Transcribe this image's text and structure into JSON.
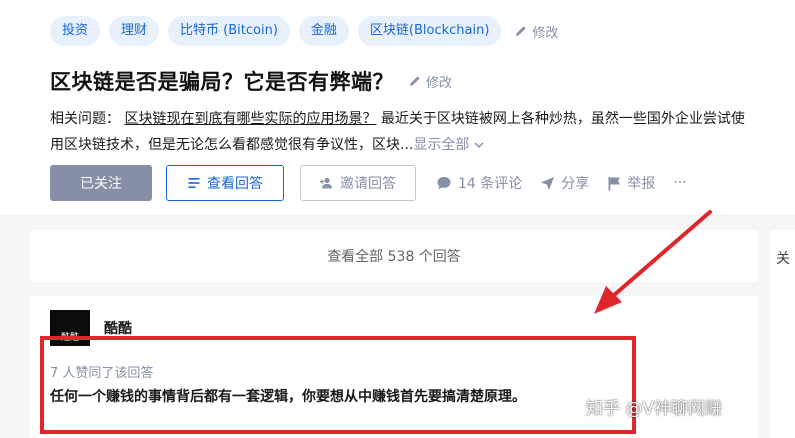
{
  "question": {
    "topics": [
      "投资",
      "理财",
      "比特币 (Bitcoin)",
      "金融",
      "区块链(Blockchain)"
    ],
    "topics_edit_label": "修改",
    "title": "区块链是否是骗局？它是否有弊端？",
    "title_edit_label": "修改",
    "detail_prefix": "相关问题：",
    "related_link": "区块链现在到底有哪些实际的应用场景？",
    "detail_text": "最近关于区块链被网上各种炒热，虽然一些国外企业尝试使用区块链技术，但是无论怎么看都感觉很有争议性，区块...",
    "show_all": "显示全部"
  },
  "actions": {
    "followed_label": "已关注",
    "view_answers_label": "查看回答",
    "invite_label": "邀请回答",
    "comments_label": "14 条评论",
    "share_label": "分享",
    "report_label": "举报",
    "more_label": "···"
  },
  "answers_bar": {
    "view_all_label": "查看全部 538 个回答"
  },
  "answer": {
    "avatar_text": "酷酷",
    "author": "酷酷",
    "voters": "7 人赞同了该回答",
    "text": "任何一个赚钱的事情背后都有一套逻辑，你要想从中赚钱首先要搞清楚原理。"
  },
  "sidebar": {
    "partial_char": "关"
  },
  "watermark": "知乎 @V神聊网赚",
  "colors": {
    "accent_blue": "#1767d8",
    "tag_bg": "#e8f0fc",
    "muted_gray": "#8590a6",
    "highlight_red": "#e0262b"
  }
}
